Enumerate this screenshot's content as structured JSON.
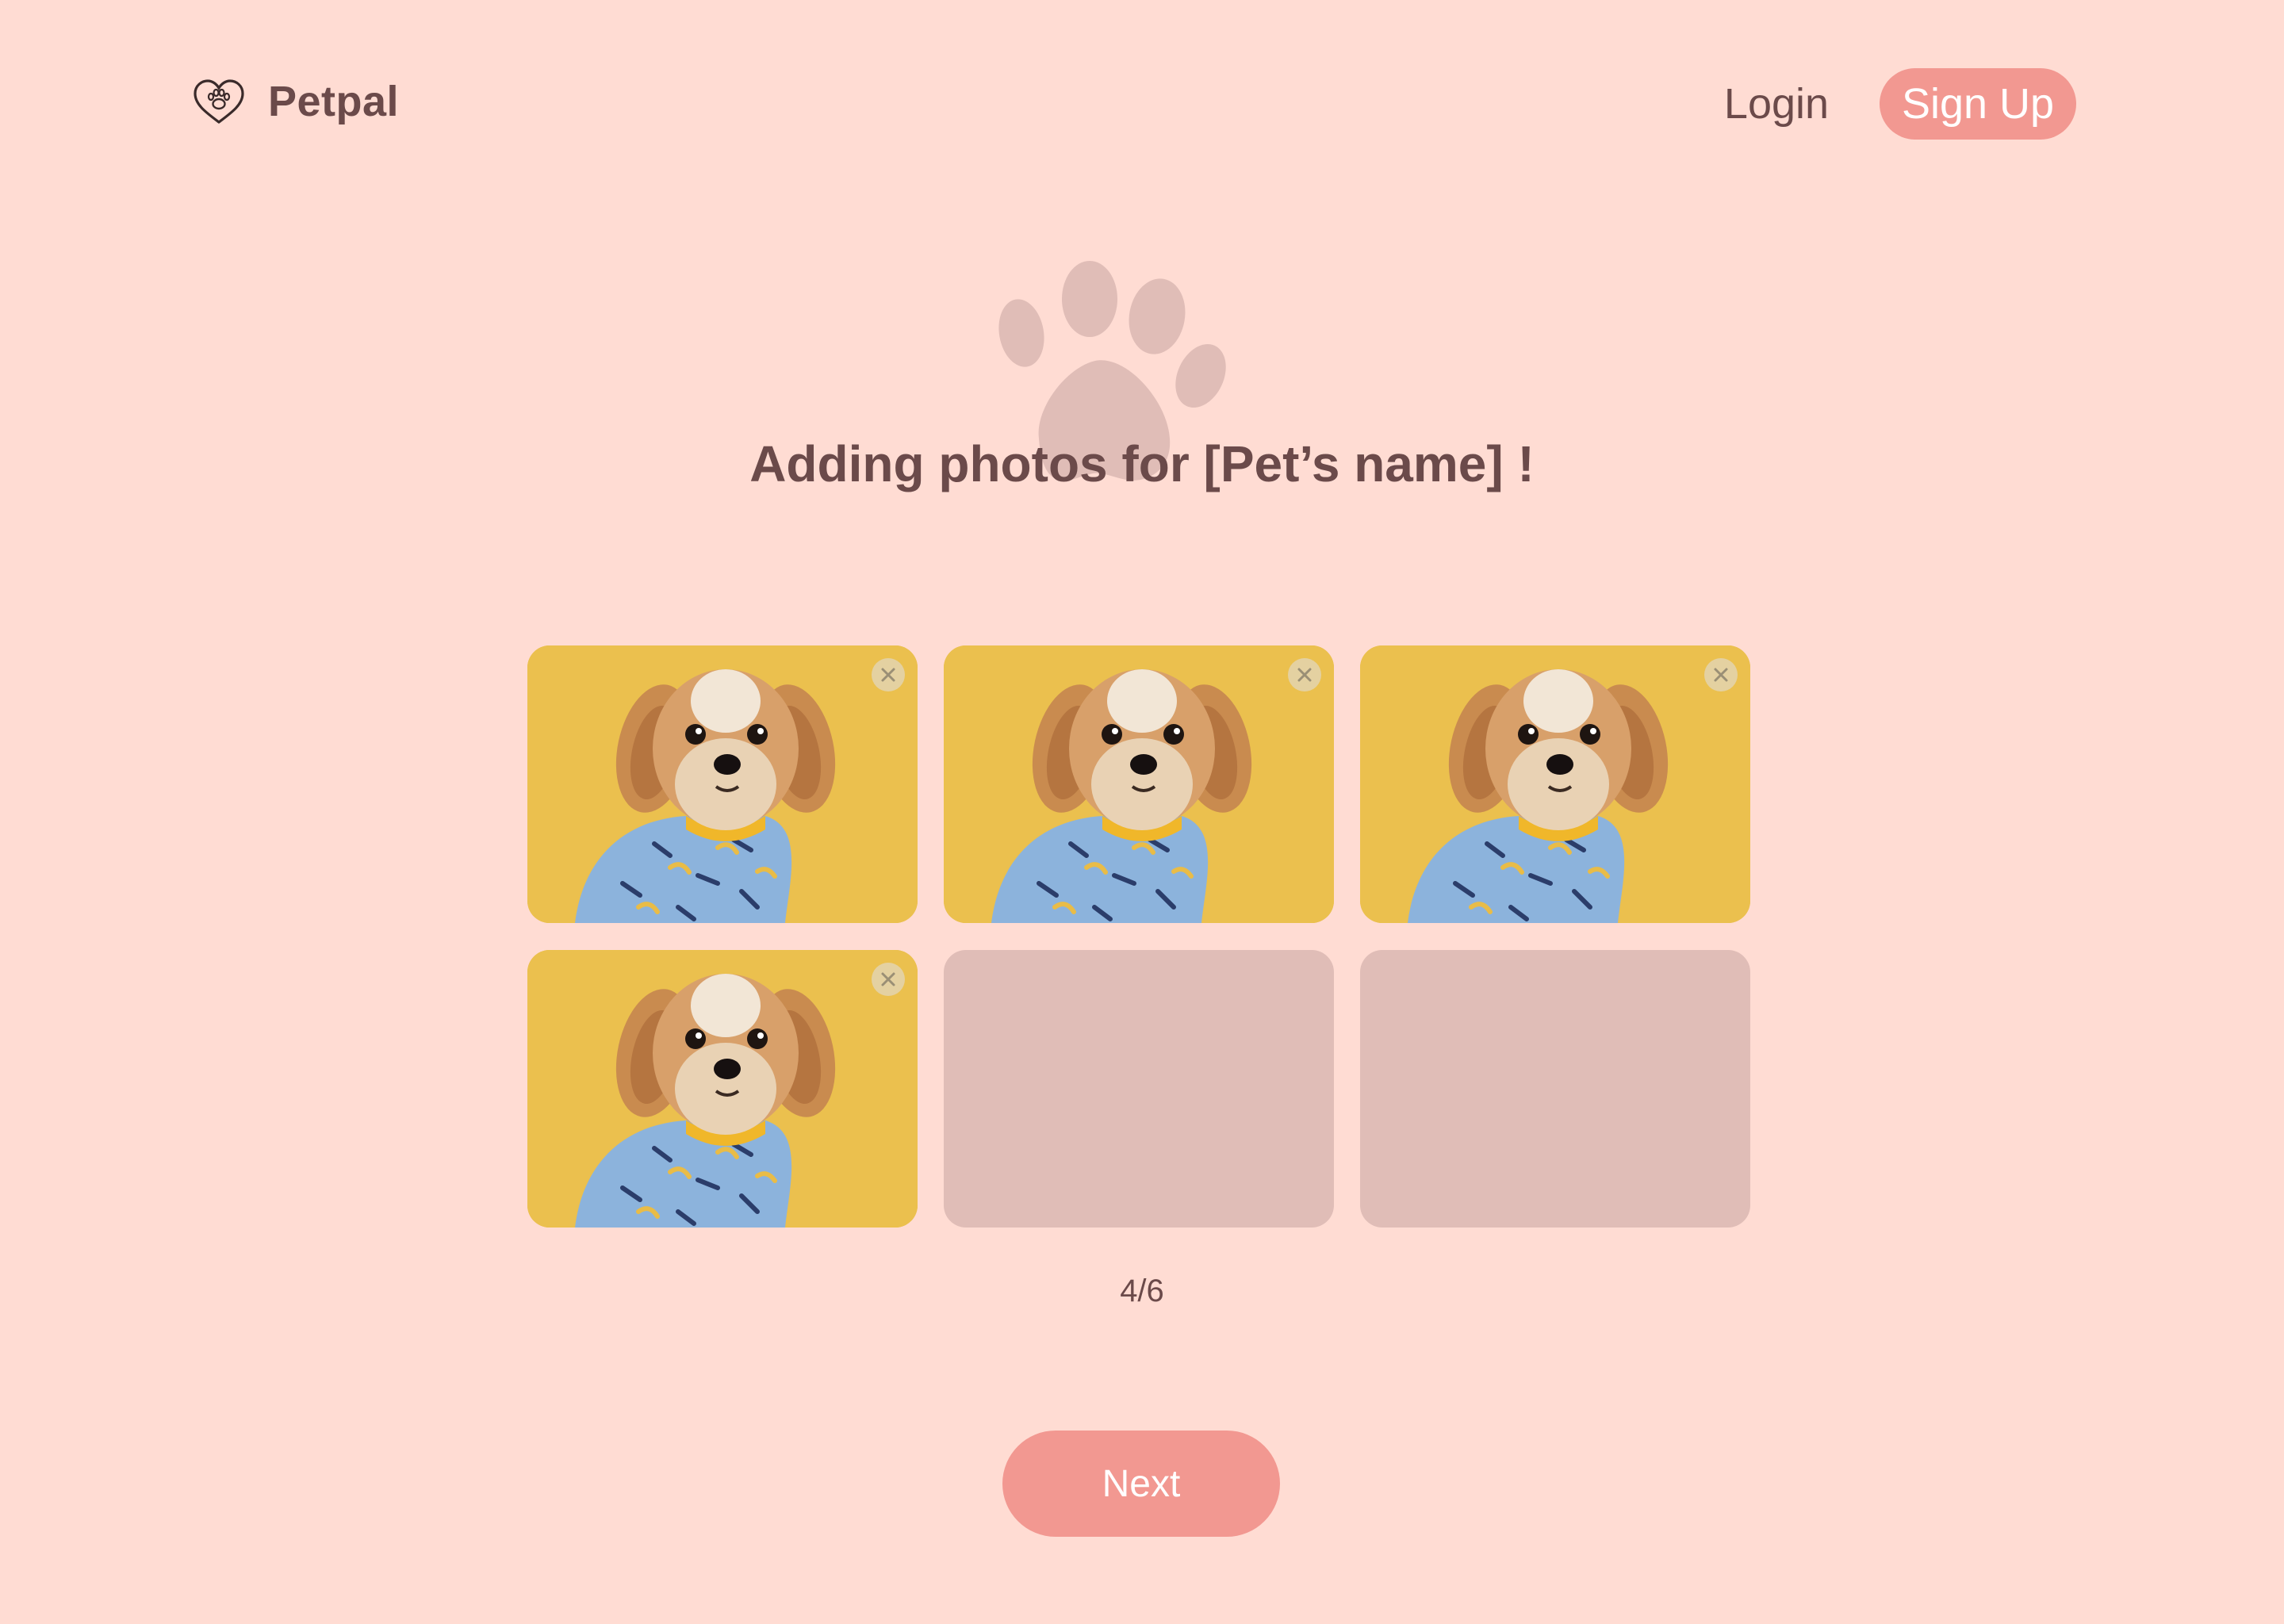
{
  "header": {
    "brand": "Petpal",
    "logo_icon": "heart-paw-icon",
    "login_label": "Login",
    "signup_label": "Sign Up"
  },
  "hero": {
    "watermark_icon": "paw-icon",
    "title": "Adding photos for [Pet’s name] !"
  },
  "photos": {
    "slots": [
      {
        "state": "filled",
        "content": "dog-photo",
        "remove_icon": "close-icon"
      },
      {
        "state": "filled",
        "content": "dog-photo",
        "remove_icon": "close-icon"
      },
      {
        "state": "filled",
        "content": "dog-photo",
        "remove_icon": "close-icon"
      },
      {
        "state": "filled",
        "content": "dog-photo",
        "remove_icon": "close-icon"
      },
      {
        "state": "empty"
      },
      {
        "state": "empty"
      }
    ],
    "counter": "4/6"
  },
  "footer": {
    "next_label": "Next"
  },
  "colors": {
    "background": "#FFDCD3",
    "accent": "#F29891",
    "text": "#6B4A4A",
    "empty_slot": "#E0BDB7",
    "photo_backdrop": "#E9BC47"
  }
}
